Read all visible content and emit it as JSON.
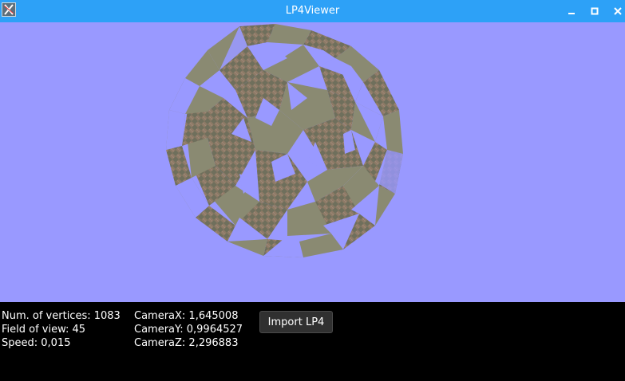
{
  "window": {
    "title": "LP4Viewer",
    "controls": [
      "minimize-icon",
      "maximize-icon",
      "close-icon"
    ]
  },
  "viewport": {
    "background": "#9999ff",
    "model_color": "#8a8a72",
    "texture_color": "#7d6a5a"
  },
  "stats": {
    "vertices": "Num. of vertices: 1083",
    "fov": "Field of view: 45",
    "speed": "Speed: 0,015"
  },
  "camera": {
    "x": "CameraX: 1,645008",
    "y": "CameraY: 0,9964527",
    "z": "CameraZ: 2,296883"
  },
  "actions": {
    "import_label": "Import LP4"
  }
}
